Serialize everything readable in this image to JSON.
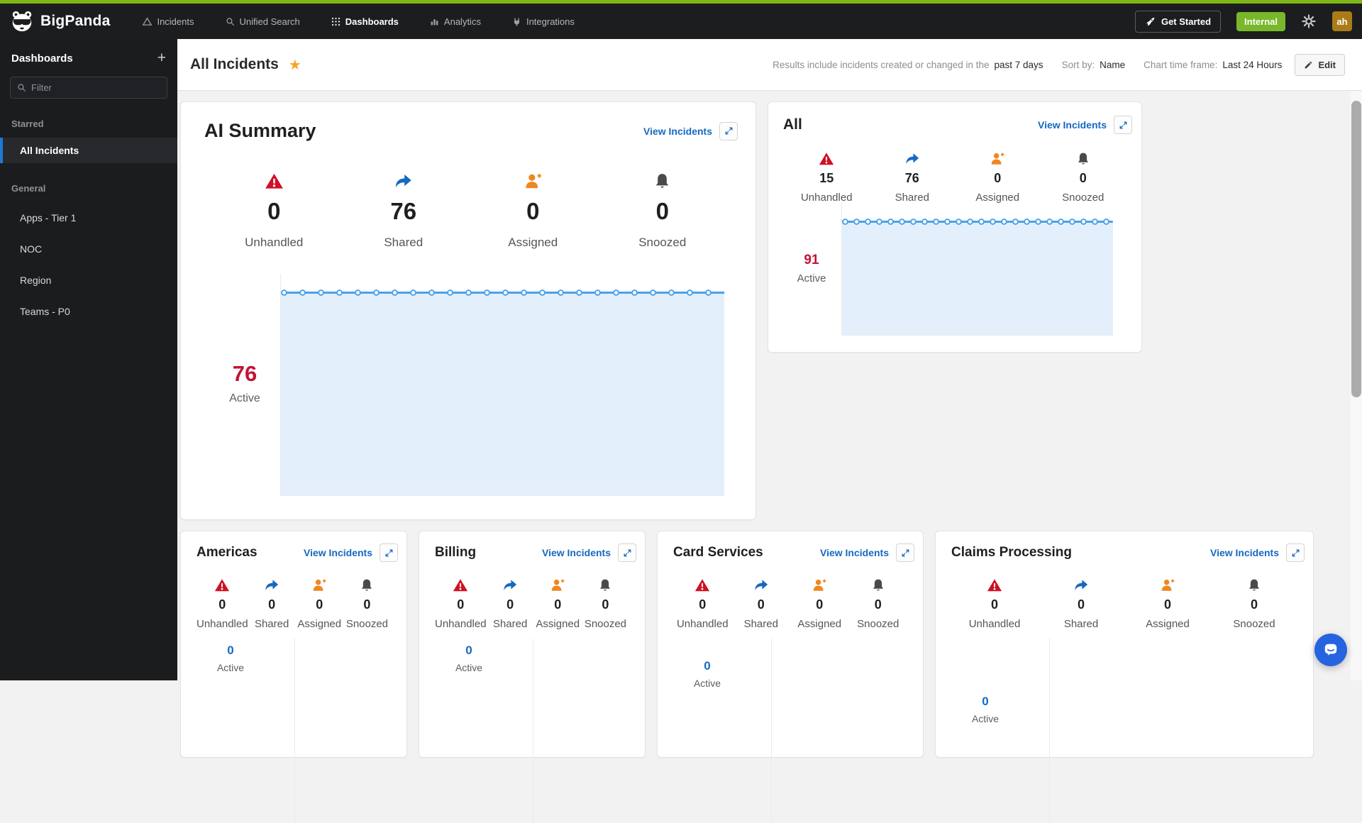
{
  "topbar": {
    "brand": "BigPanda",
    "nav": {
      "incidents": "Incidents",
      "unified_search": "Unified Search",
      "dashboards": "Dashboards",
      "analytics": "Analytics",
      "integrations": "Integrations"
    },
    "get_started": "Get Started",
    "environment_badge": "Internal",
    "avatar_initials": "ah"
  },
  "sidebar": {
    "title": "Dashboards",
    "filter_placeholder": "Filter",
    "starred_label": "Starred",
    "starred_items": {
      "all_incidents": "All Incidents"
    },
    "general_label": "General",
    "general_items": {
      "apps_tier1": "Apps - Tier 1",
      "noc": "NOC",
      "region": "Region",
      "teams_p0": "Teams - P0"
    }
  },
  "header": {
    "title": "All Incidents",
    "meta_prefix": "Results include incidents created or changed in the",
    "meta_range": "past 7 days",
    "sort_label": "Sort by:",
    "sort_value": "Name",
    "timeframe_label": "Chart time frame:",
    "timeframe_value": "Last 24 Hours",
    "edit": "Edit"
  },
  "cards": {
    "ai_summary": {
      "title": "AI Summary",
      "view_incidents": "View Incidents",
      "stats": [
        {
          "label": "Unhandled",
          "value": "0"
        },
        {
          "label": "Shared",
          "value": "76"
        },
        {
          "label": "Assigned",
          "value": "0"
        },
        {
          "label": "Snoozed",
          "value": "0"
        }
      ],
      "active_value": "76",
      "active_label": "Active",
      "chart": {
        "type": "line",
        "flat_value": 76,
        "points": 25,
        "x_range": "Last 24 Hours"
      }
    },
    "all": {
      "title": "All",
      "view_incidents": "View Incidents",
      "stats": [
        {
          "label": "Unhandled",
          "value": "15"
        },
        {
          "label": "Shared",
          "value": "76"
        },
        {
          "label": "Assigned",
          "value": "0"
        },
        {
          "label": "Snoozed",
          "value": "0"
        }
      ],
      "active_value": "91",
      "active_label": "Active",
      "chart": {
        "type": "line",
        "flat_value": 91,
        "points": 25,
        "x_range": "Last 24 Hours"
      }
    },
    "americas": {
      "title": "Americas",
      "view_incidents": "View Incidents",
      "stats": [
        {
          "label": "Unhandled",
          "value": "0"
        },
        {
          "label": "Shared",
          "value": "0"
        },
        {
          "label": "Assigned",
          "value": "0"
        },
        {
          "label": "Snoozed",
          "value": "0"
        }
      ],
      "active_value": "0",
      "active_label": "Active",
      "chart": {
        "type": "line",
        "flat_value": 0,
        "points": 0,
        "x_range": "Last 24 Hours"
      }
    },
    "billing": {
      "title": "Billing",
      "view_incidents": "View Incidents",
      "stats": [
        {
          "label": "Unhandled",
          "value": "0"
        },
        {
          "label": "Shared",
          "value": "0"
        },
        {
          "label": "Assigned",
          "value": "0"
        },
        {
          "label": "Snoozed",
          "value": "0"
        }
      ],
      "active_value": "0",
      "active_label": "Active",
      "chart": {
        "type": "line",
        "flat_value": 0,
        "points": 0,
        "x_range": "Last 24 Hours"
      }
    },
    "card_services": {
      "title": "Card Services",
      "view_incidents": "View Incidents",
      "stats": [
        {
          "label": "Unhandled",
          "value": "0"
        },
        {
          "label": "Shared",
          "value": "0"
        },
        {
          "label": "Assigned",
          "value": "0"
        },
        {
          "label": "Snoozed",
          "value": "0"
        }
      ],
      "active_value": "0",
      "active_label": "Active",
      "chart": {
        "type": "line",
        "flat_value": 0,
        "points": 0,
        "x_range": "Last 24 Hours"
      }
    },
    "claims_processing": {
      "title": "Claims Processing",
      "view_incidents": "View Incidents",
      "stats": [
        {
          "label": "Unhandled",
          "value": "0"
        },
        {
          "label": "Shared",
          "value": "0"
        },
        {
          "label": "Assigned",
          "value": "0"
        },
        {
          "label": "Snoozed",
          "value": "0"
        }
      ],
      "active_value": "0",
      "active_label": "Active",
      "chart": {
        "type": "line",
        "flat_value": 0,
        "points": 0,
        "x_range": "Last 24 Hours"
      }
    }
  },
  "colors": {
    "brand_green": "#7fb616",
    "badge_green": "#78b82a",
    "accent_blue": "#1669c1",
    "alert_red": "#ce1126",
    "active_red": "#c51236",
    "assign_orange": "#ee8822",
    "snooze_gray": "#4a4a4a",
    "chart_line": "#4ba1e9",
    "chart_fill": "#e3f0fb",
    "selected_bar_blue": "#1d79d8"
  }
}
